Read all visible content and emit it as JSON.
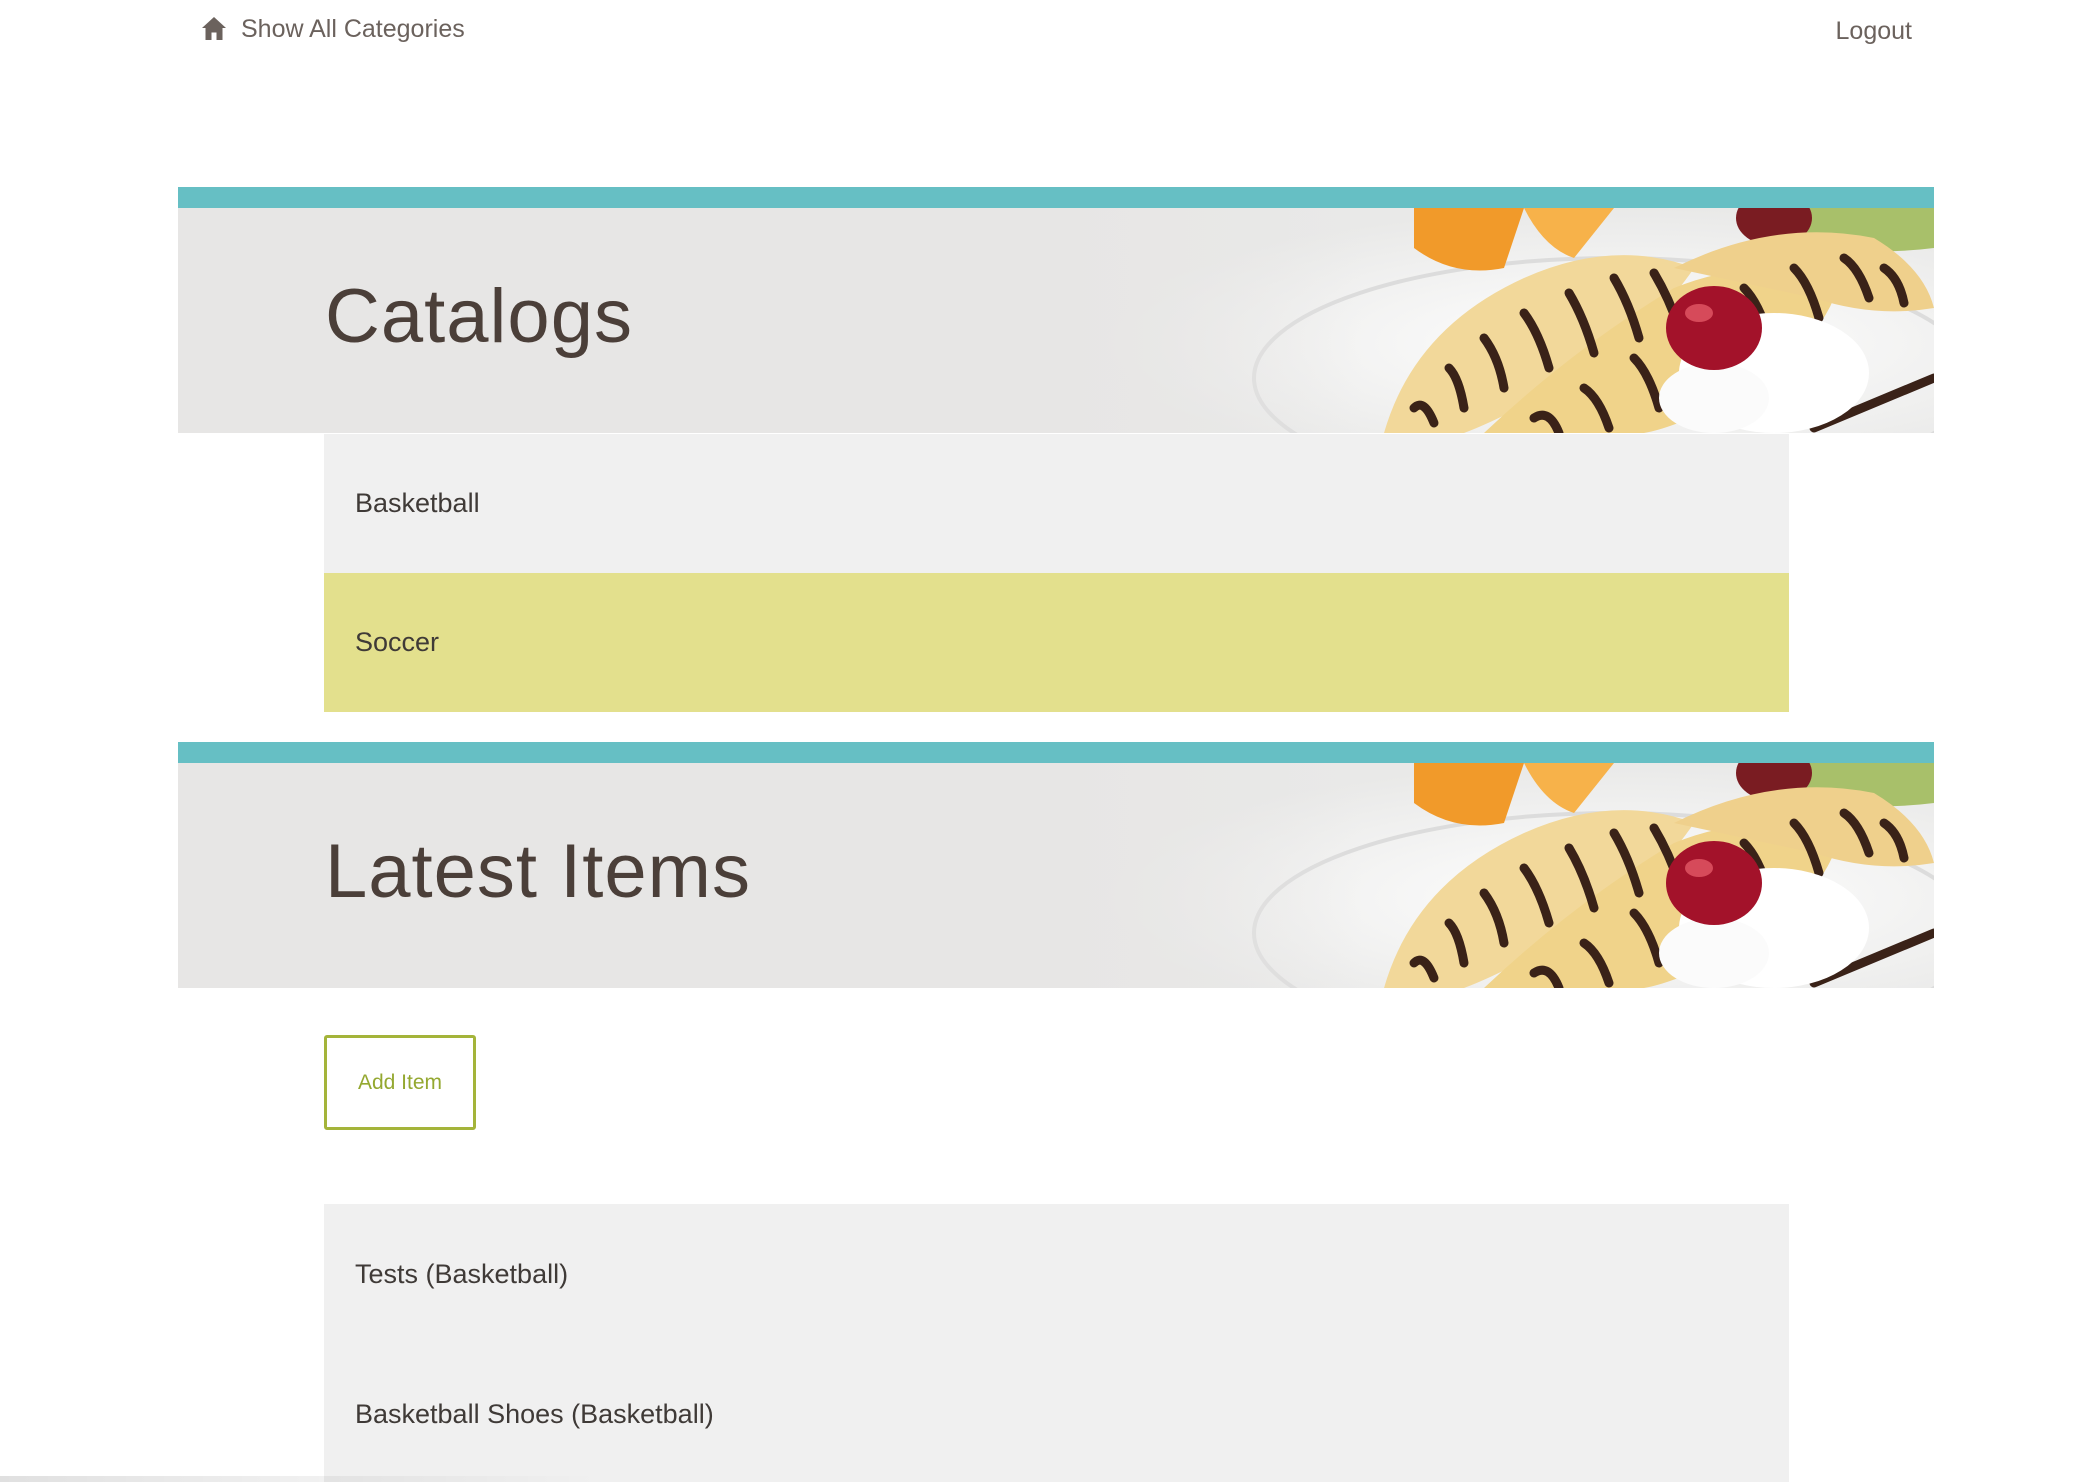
{
  "nav": {
    "home_icon": "home-icon",
    "home_label": "Show All Categories",
    "logout_label": "Logout"
  },
  "catalogs": {
    "title": "Catalogs",
    "items": [
      {
        "label": "Basketball"
      },
      {
        "label": "Soccer"
      }
    ]
  },
  "latest": {
    "title": "Latest Items",
    "add_button_label": "Add Item",
    "items": [
      {
        "label": "Tests (Basketball)"
      },
      {
        "label": "Basketball Shoes (Basketball)"
      }
    ]
  },
  "colors": {
    "accent_bar": "#66bfc4",
    "highlight": "#e3e08d",
    "button_border": "#a4b43a",
    "list_bg": "#f0f0f0",
    "banner_bg": "#e7e6e5"
  }
}
